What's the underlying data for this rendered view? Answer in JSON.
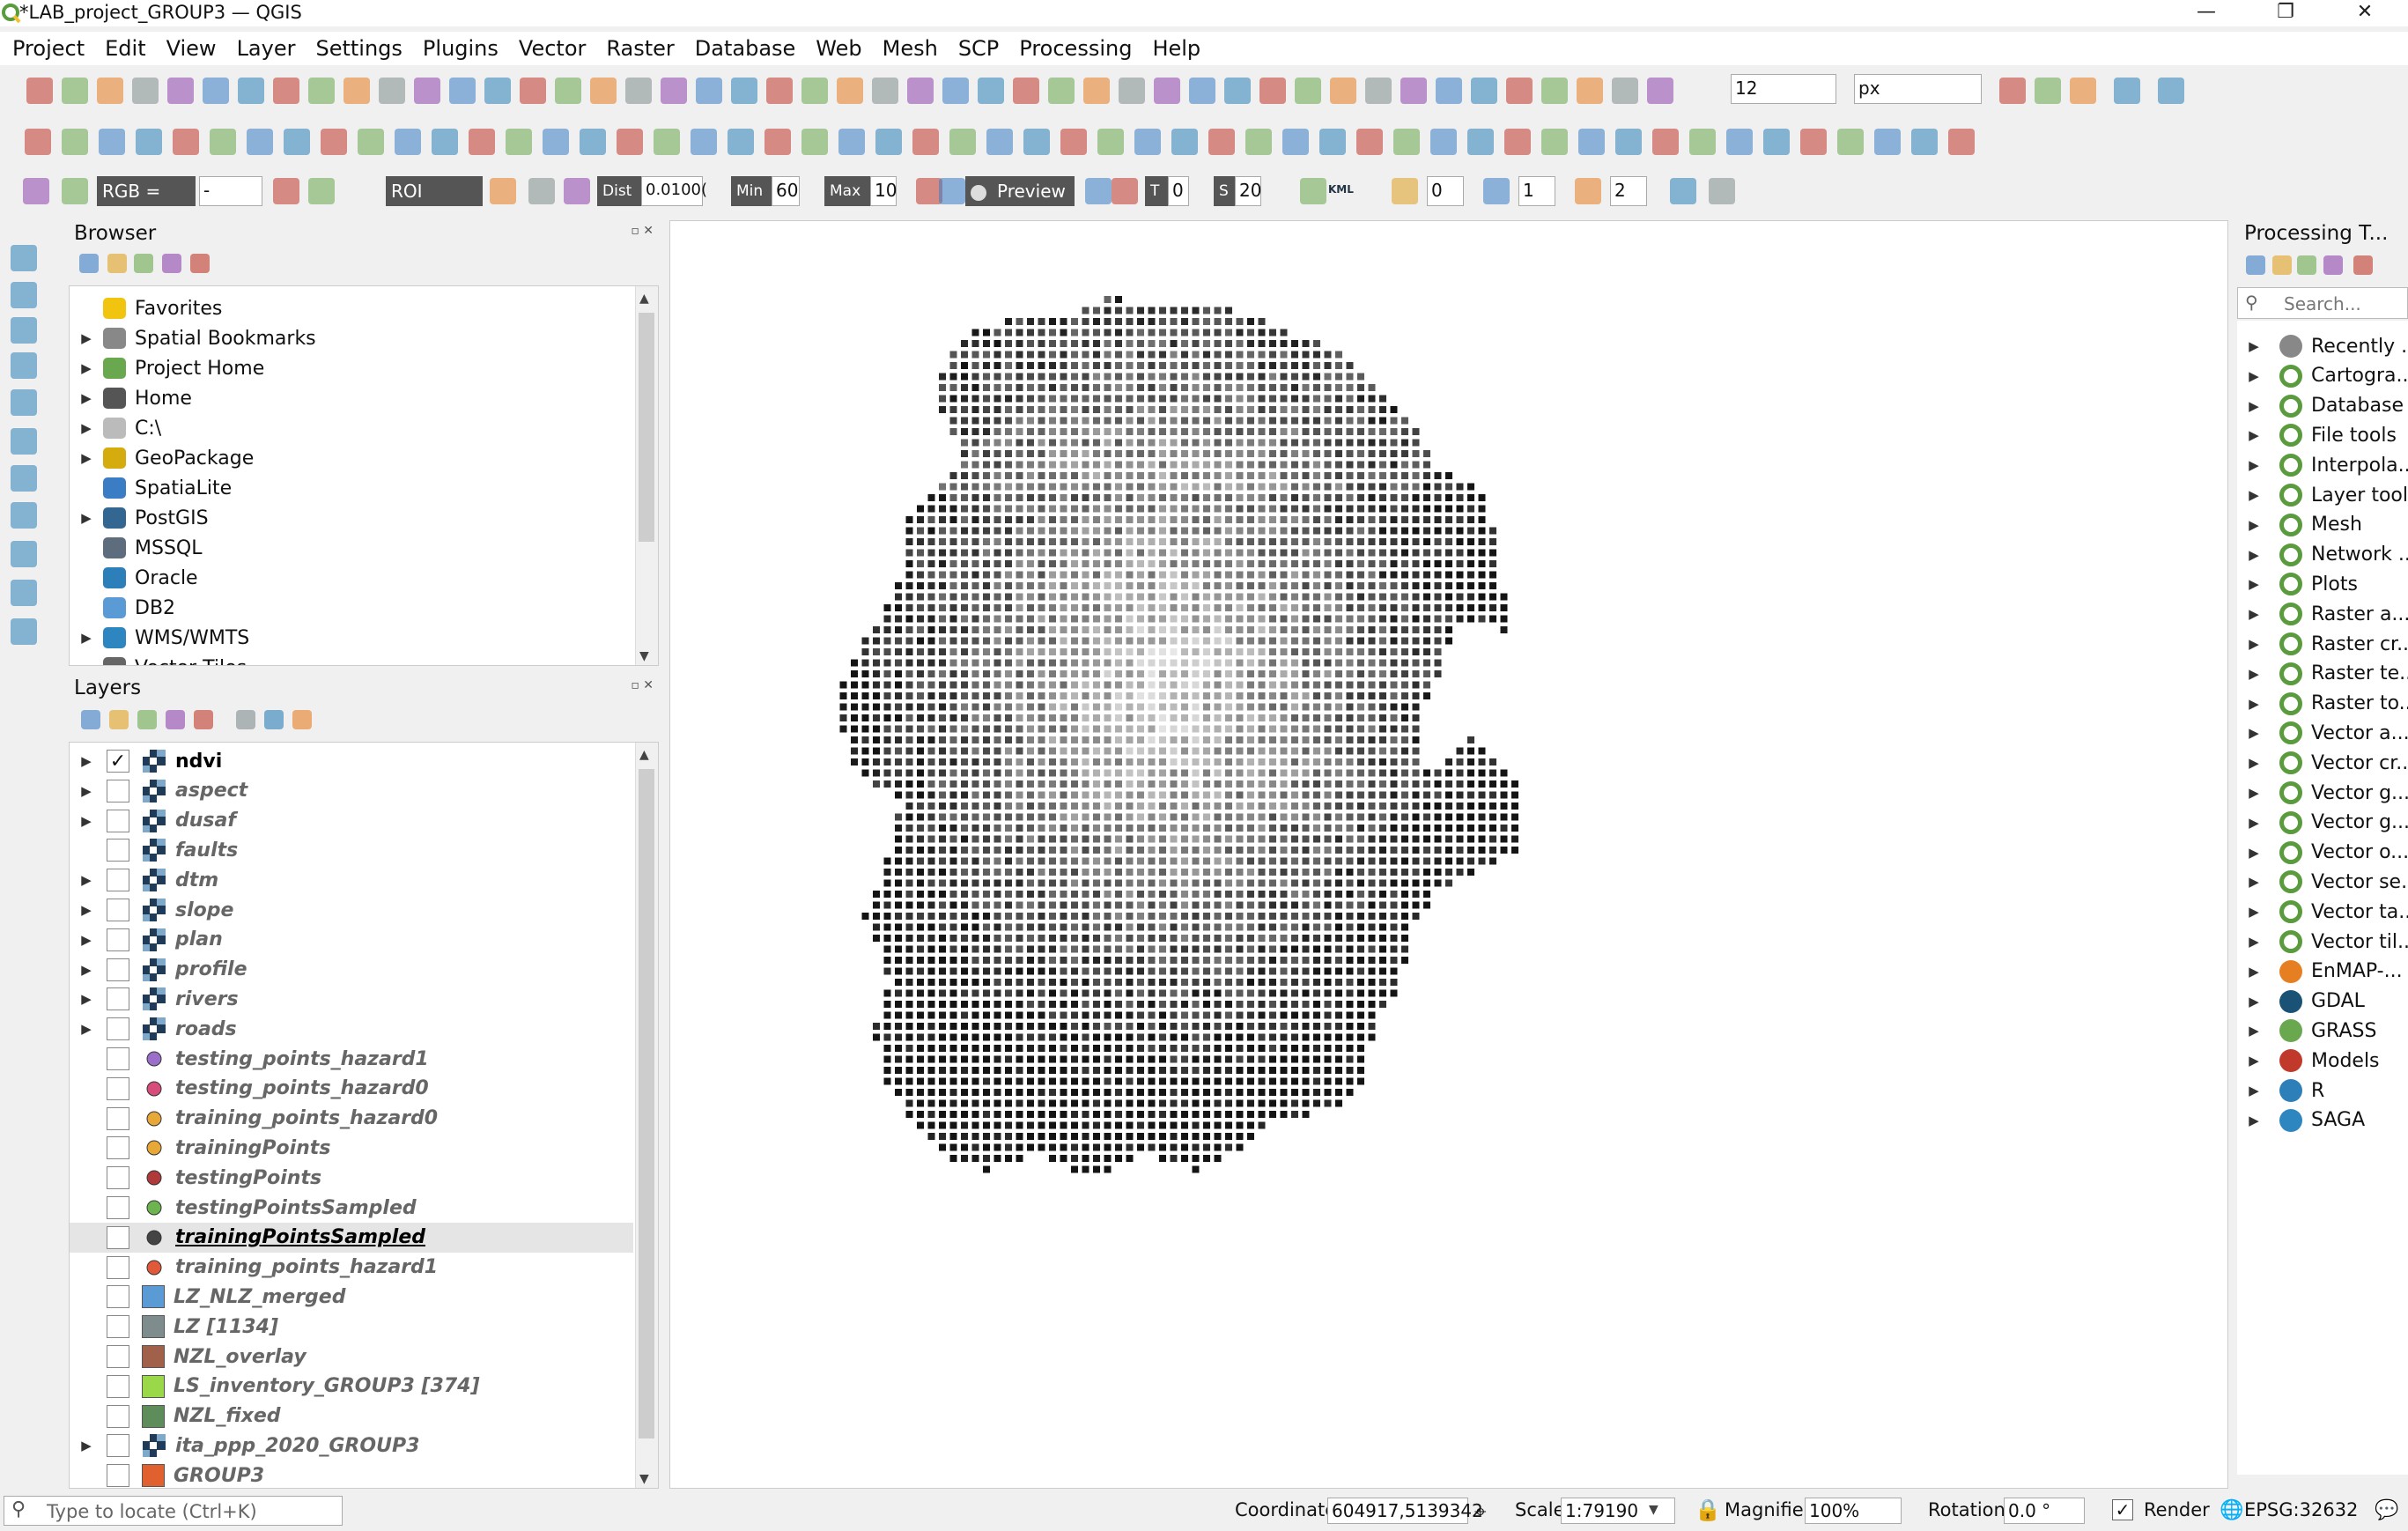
{
  "window": {
    "title": "*LAB_project_GROUP3 — QGIS"
  },
  "menu": [
    "Project",
    "Edit",
    "View",
    "Layer",
    "Settings",
    "Plugins",
    "Vector",
    "Raster",
    "Database",
    "Web",
    "Mesh",
    "SCP",
    "Processing",
    "Help"
  ],
  "toolbar": {
    "font_size_value": "12",
    "font_unit": "px",
    "rgb_label": "RGB =",
    "rgb_value": "-",
    "roi_label": "ROI",
    "dist_label": "Dist",
    "dist_value": "0.0100(",
    "min_label": "Min",
    "min_value": "60",
    "max_label": "Max",
    "max_value": "10",
    "preview_label": "Preview",
    "t_label": "T",
    "t_value": "0",
    "s_label": "S",
    "s_value": "20",
    "kml_label": "KML",
    "band_a_value": "0",
    "band_b_value": "1",
    "band_c_value": "2"
  },
  "browser": {
    "title": "Browser",
    "items": [
      {
        "label": "Favorites",
        "icon": "star-icon",
        "expandable": false
      },
      {
        "label": "Spatial Bookmarks",
        "icon": "bookmark-icon",
        "expandable": true
      },
      {
        "label": "Project Home",
        "icon": "project-home-icon",
        "expandable": true
      },
      {
        "label": "Home",
        "icon": "home-icon",
        "expandable": true
      },
      {
        "label": "C:\\",
        "icon": "folder-icon",
        "expandable": true
      },
      {
        "label": "GeoPackage",
        "icon": "geopackage-icon",
        "expandable": true
      },
      {
        "label": "SpatiaLite",
        "icon": "spatialite-icon",
        "expandable": false
      },
      {
        "label": "PostGIS",
        "icon": "postgis-icon",
        "expandable": true
      },
      {
        "label": "MSSQL",
        "icon": "mssql-icon",
        "expandable": false
      },
      {
        "label": "Oracle",
        "icon": "oracle-icon",
        "expandable": false
      },
      {
        "label": "DB2",
        "icon": "db2-icon",
        "expandable": false
      },
      {
        "label": "WMS/WMTS",
        "icon": "wms-icon",
        "expandable": true
      },
      {
        "label": "Vector Tiles",
        "icon": "vector-tiles-icon",
        "expandable": false
      }
    ]
  },
  "layers": {
    "title": "Layers",
    "items": [
      {
        "name": "ndvi",
        "type": "raster",
        "checked": true,
        "expandable": true,
        "active": true
      },
      {
        "name": "aspect",
        "type": "raster",
        "checked": false,
        "expandable": true
      },
      {
        "name": "dusaf",
        "type": "raster",
        "checked": false,
        "expandable": true
      },
      {
        "name": "faults",
        "type": "raster",
        "checked": false,
        "expandable": false
      },
      {
        "name": "dtm",
        "type": "raster",
        "checked": false,
        "expandable": true
      },
      {
        "name": "slope",
        "type": "raster",
        "checked": false,
        "expandable": true
      },
      {
        "name": "plan",
        "type": "raster",
        "checked": false,
        "expandable": true
      },
      {
        "name": "profile",
        "type": "raster",
        "checked": false,
        "expandable": true
      },
      {
        "name": "rivers",
        "type": "raster",
        "checked": false,
        "expandable": true
      },
      {
        "name": "roads",
        "type": "raster",
        "checked": false,
        "expandable": true
      },
      {
        "name": "testing_points_hazard1",
        "type": "point",
        "color": "#9b6fc9",
        "checked": false
      },
      {
        "name": "testing_points_hazard0",
        "type": "point",
        "color": "#d64c7a",
        "checked": false
      },
      {
        "name": "training_points_hazard0",
        "type": "point",
        "color": "#e8a838",
        "checked": false
      },
      {
        "name": "trainingPoints",
        "type": "point",
        "color": "#e8a838",
        "checked": false
      },
      {
        "name": "testingPoints",
        "type": "point",
        "color": "#b03a3a",
        "checked": false
      },
      {
        "name": "testingPointsSampled",
        "type": "point",
        "color": "#6db34f",
        "checked": false
      },
      {
        "name": "trainingPointsSampled",
        "type": "point",
        "color": "#444444",
        "checked": false,
        "selected": true
      },
      {
        "name": "training_points_hazard1",
        "type": "point",
        "color": "#e05a3a",
        "checked": false
      },
      {
        "name": "LZ_NLZ_merged",
        "type": "polygon",
        "color": "#5b9bd5",
        "checked": false
      },
      {
        "name": "LZ [1134]",
        "type": "polygon",
        "color": "#7f8c8d",
        "checked": false
      },
      {
        "name": "NZL_overlay",
        "type": "polygon",
        "color": "#a0604a",
        "checked": false
      },
      {
        "name": "LS_inventory_GROUP3 [374]",
        "type": "polygon",
        "color": "#9ad84a",
        "checked": false
      },
      {
        "name": "NZL_fixed",
        "type": "polygon",
        "color": "#5e8c5a",
        "checked": false
      },
      {
        "name": "ita_ppp_2020_GROUP3",
        "type": "raster",
        "checked": false,
        "expandable": true
      },
      {
        "name": "GROUP3",
        "type": "polygon",
        "color": "#e06030",
        "checked": false
      }
    ]
  },
  "processing": {
    "title": "Processing T...",
    "search_placeholder": "Search...",
    "items": [
      {
        "label": "Recently ...",
        "icon": "clock-icon"
      },
      {
        "label": "Cartogra...",
        "icon": "qgis-icon"
      },
      {
        "label": "Database",
        "icon": "qgis-icon"
      },
      {
        "label": "File tools",
        "icon": "qgis-icon"
      },
      {
        "label": "Interpola...",
        "icon": "qgis-icon"
      },
      {
        "label": "Layer tool",
        "icon": "qgis-icon"
      },
      {
        "label": "Mesh",
        "icon": "qgis-icon"
      },
      {
        "label": "Network ...",
        "icon": "qgis-icon"
      },
      {
        "label": "Plots",
        "icon": "qgis-icon"
      },
      {
        "label": "Raster a...",
        "icon": "qgis-icon"
      },
      {
        "label": "Raster cr...",
        "icon": "qgis-icon"
      },
      {
        "label": "Raster te...",
        "icon": "qgis-icon"
      },
      {
        "label": "Raster to...",
        "icon": "qgis-icon"
      },
      {
        "label": "Vector a...",
        "icon": "qgis-icon"
      },
      {
        "label": "Vector cr...",
        "icon": "qgis-icon"
      },
      {
        "label": "Vector g...",
        "icon": "qgis-icon"
      },
      {
        "label": "Vector g...",
        "icon": "qgis-icon"
      },
      {
        "label": "Vector o...",
        "icon": "qgis-icon"
      },
      {
        "label": "Vector se...",
        "icon": "qgis-icon"
      },
      {
        "label": "Vector ta...",
        "icon": "qgis-icon"
      },
      {
        "label": "Vector til...",
        "icon": "qgis-icon"
      },
      {
        "label": "EnMAP-...",
        "icon": "enmap-icon"
      },
      {
        "label": "GDAL",
        "icon": "gdal-icon"
      },
      {
        "label": "GRASS",
        "icon": "grass-icon"
      },
      {
        "label": "Models",
        "icon": "models-icon"
      },
      {
        "label": "R",
        "icon": "r-icon"
      },
      {
        "label": "SAGA",
        "icon": "saga-icon"
      }
    ]
  },
  "statusbar": {
    "locate_placeholder": "Type to locate (Ctrl+K)",
    "coordinate_label": "Coordinate",
    "coordinate_value": "604917,5139342",
    "scale_label": "Scale",
    "scale_value": "1:79190",
    "magnifier_label": "Magnifier",
    "magnifier_value": "100%",
    "rotation_label": "Rotation",
    "rotation_value": "0.0 °",
    "render_label": "Render",
    "crs_label": "EPSG:32632"
  },
  "colors": {
    "qgis_green": "#5a9b3d",
    "selection": "#e5e5e5"
  }
}
